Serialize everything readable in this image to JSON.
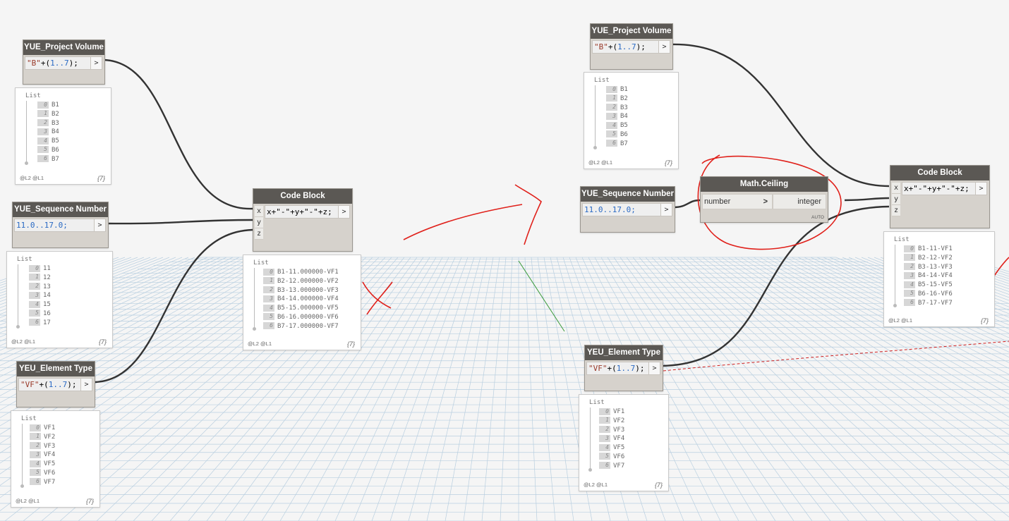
{
  "list_title": "List",
  "levels": "@L2 @L1",
  "left": {
    "project_volume": {
      "title": "YUE_Project Volume",
      "code_str": "\"B\"",
      "code_plus": "+(",
      "code_range": "1..7",
      "code_tail": ");",
      "out": ">",
      "preview": {
        "items": [
          "B1",
          "B2",
          "B3",
          "B4",
          "B5",
          "B6",
          "B7"
        ],
        "count": "{7}"
      }
    },
    "sequence_number": {
      "title": "YUE_Sequence Number",
      "code": "11.0..17.0;",
      "out": ">",
      "preview": {
        "items": [
          "11",
          "12",
          "13",
          "14",
          "15",
          "16",
          "17"
        ],
        "count": "{7}"
      }
    },
    "element_type": {
      "title": "YEU_Element Type",
      "code_str": "\"VF\"",
      "code_plus": "+(",
      "code_range": "1..7",
      "code_tail": ");",
      "out": ">",
      "preview": {
        "items": [
          "VF1",
          "VF2",
          "VF3",
          "VF4",
          "VF5",
          "VF6",
          "VF7"
        ],
        "count": "{7}"
      }
    },
    "code_block": {
      "title": "Code Block",
      "code": "x+\"-\"+y+\"-\"+z;",
      "out": ">",
      "ports": [
        "x",
        "y",
        "z"
      ],
      "preview": {
        "items": [
          "B1-11.000000-VF1",
          "B2-12.000000-VF2",
          "B3-13.000000-VF3",
          "B4-14.000000-VF4",
          "B5-15.000000-VF5",
          "B6-16.000000-VF6",
          "B7-17.000000-VF7"
        ],
        "count": "{7}"
      }
    }
  },
  "right": {
    "project_volume": {
      "title": "YUE_Project Volume",
      "code_str": "\"B\"",
      "code_plus": "+(",
      "code_range": "1..7",
      "code_tail": ");",
      "out": ">",
      "preview": {
        "items": [
          "B1",
          "B2",
          "B3",
          "B4",
          "B5",
          "B6",
          "B7"
        ],
        "count": "{7}"
      }
    },
    "sequence_number": {
      "title": "YUE_Sequence Number",
      "code": "11.0..17.0;",
      "out": ">"
    },
    "math_ceiling": {
      "title": "Math.Ceiling",
      "input_label": "number",
      "input_arrow": ">",
      "output_label": "integer",
      "out": ">",
      "lacing": "AUTO"
    },
    "element_type": {
      "title": "YEU_Element Type",
      "code_str": "\"VF\"",
      "code_plus": "+(",
      "code_range": "1..7",
      "code_tail": ");",
      "out": ">",
      "preview": {
        "items": [
          "VF1",
          "VF2",
          "VF3",
          "VF4",
          "VF5",
          "VF6",
          "VF7"
        ],
        "count": "{7}"
      }
    },
    "code_block": {
      "title": "Code Block",
      "code": "x+\"-\"+y+\"-\"+z;",
      "out": ">",
      "ports": [
        "x",
        "y",
        "z"
      ],
      "preview": {
        "items": [
          "B1-11-VF1",
          "B2-12-VF2",
          "B3-13-VF3",
          "B4-14-VF4",
          "B5-15-VF5",
          "B6-16-VF6",
          "B7-17-VF7"
        ],
        "count": "{7}"
      }
    }
  },
  "colors": {
    "node_header": "#5b5854",
    "node_body": "#d6d2cc",
    "wire": "#333333",
    "annotation": "#e0201a",
    "grid": "#b9cfe0"
  }
}
